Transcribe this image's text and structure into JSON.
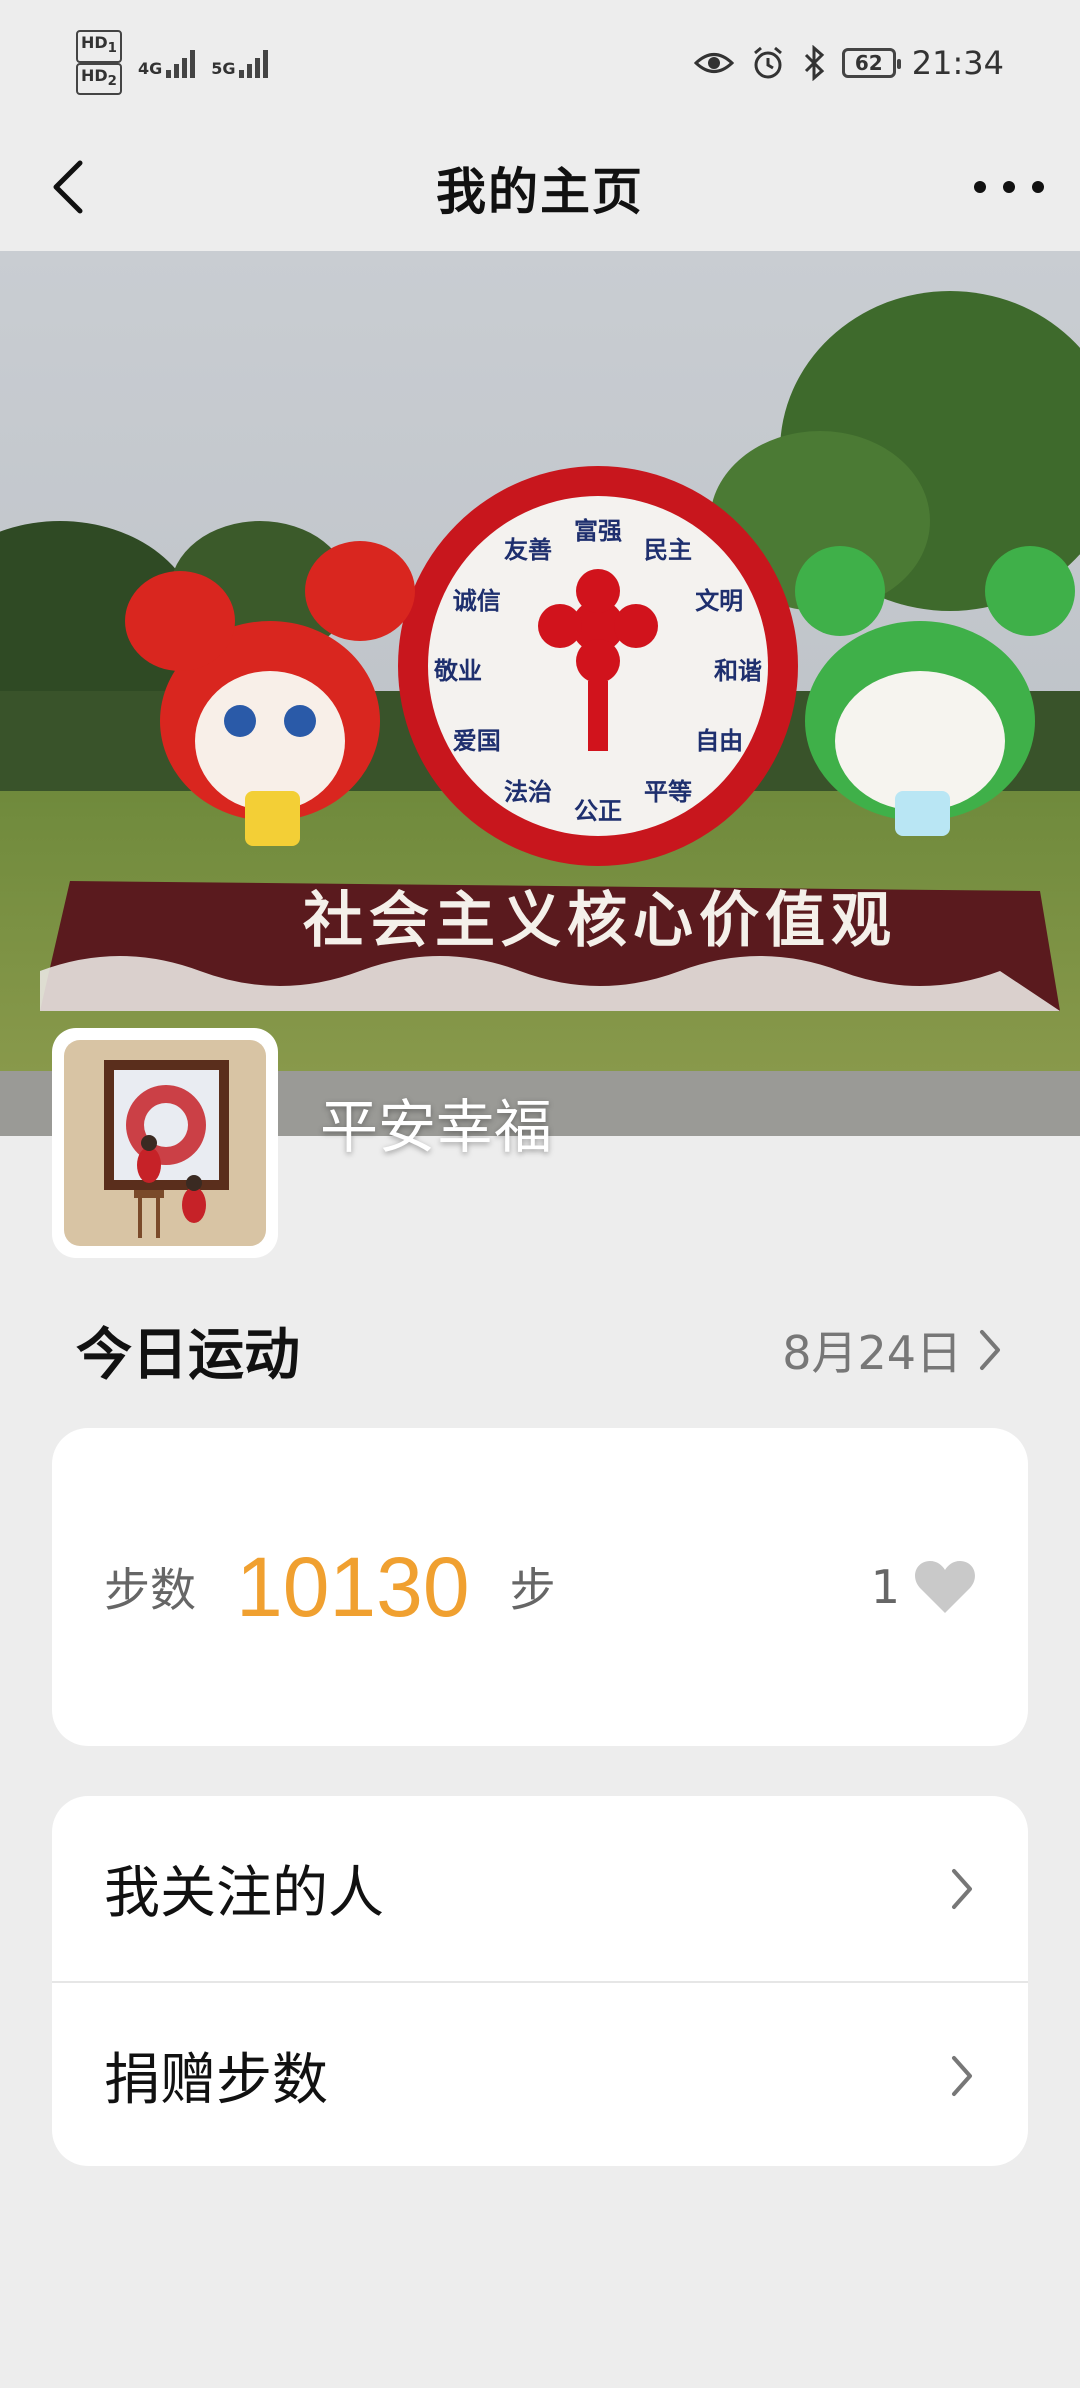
{
  "status_bar": {
    "hd1": "HD",
    "hd1_sub": "1",
    "hd2": "HD",
    "hd2_sub": "2",
    "net1": "4G",
    "net2": "5G",
    "battery": "62",
    "time": "21:34"
  },
  "header": {
    "title": "我的主页"
  },
  "hero": {
    "sign_text": "社会主义核心价值观",
    "values": [
      "富强",
      "民主",
      "文明",
      "和谐",
      "自由",
      "平等",
      "公正",
      "法治",
      "爱国",
      "敬业",
      "诚信",
      "友善"
    ]
  },
  "profile": {
    "nickname": "平安幸福"
  },
  "today": {
    "title": "今日运动",
    "date": "8月24日"
  },
  "steps": {
    "label": "步数",
    "value": "10130",
    "unit": "步",
    "likes": "1"
  },
  "menu": {
    "items": [
      {
        "label": "我关注的人"
      },
      {
        "label": "捐赠步数"
      }
    ]
  },
  "colors": {
    "accent": "#f0a030",
    "background": "#ededed"
  }
}
